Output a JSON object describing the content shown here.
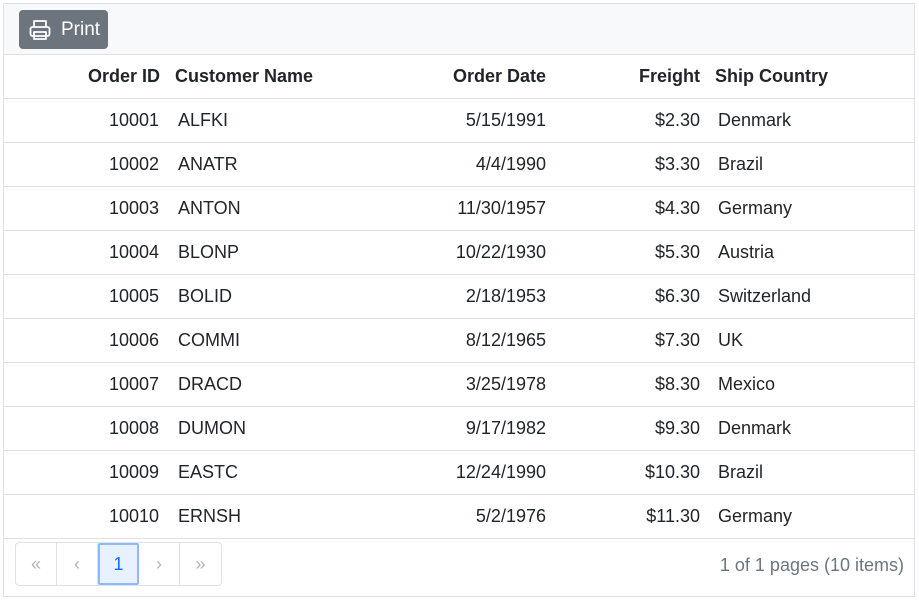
{
  "toolbar": {
    "print_label": "Print",
    "print_icon": "printer-icon"
  },
  "columns": [
    "Order ID",
    "Customer Name",
    "Order Date",
    "Freight",
    "Ship Country"
  ],
  "rows": [
    [
      "10001",
      "ALFKI",
      "5/15/1991",
      "$2.30",
      "Denmark"
    ],
    [
      "10002",
      "ANATR",
      "4/4/1990",
      "$3.30",
      "Brazil"
    ],
    [
      "10003",
      "ANTON",
      "11/30/1957",
      "$4.30",
      "Germany"
    ],
    [
      "10004",
      "BLONP",
      "10/22/1930",
      "$5.30",
      "Austria"
    ],
    [
      "10005",
      "BOLID",
      "2/18/1953",
      "$6.30",
      "Switzerland"
    ],
    [
      "10006",
      "COMMI",
      "8/12/1965",
      "$7.30",
      "UK"
    ],
    [
      "10007",
      "DRACD",
      "3/25/1978",
      "$8.30",
      "Mexico"
    ],
    [
      "10008",
      "DUMON",
      "9/17/1982",
      "$9.30",
      "Denmark"
    ],
    [
      "10009",
      "EASTC",
      "12/24/1990",
      "$10.30",
      "Brazil"
    ],
    [
      "10010",
      "ERNSH",
      "5/2/1976",
      "$11.30",
      "Germany"
    ]
  ],
  "pager": {
    "first": "«",
    "prev": "‹",
    "current": "1",
    "next": "›",
    "last": "»",
    "info": "1 of 1 pages (10 items)"
  },
  "colors": {
    "accent": "#0d6efd",
    "button": "#6c757d",
    "border": "#dee2e6"
  }
}
